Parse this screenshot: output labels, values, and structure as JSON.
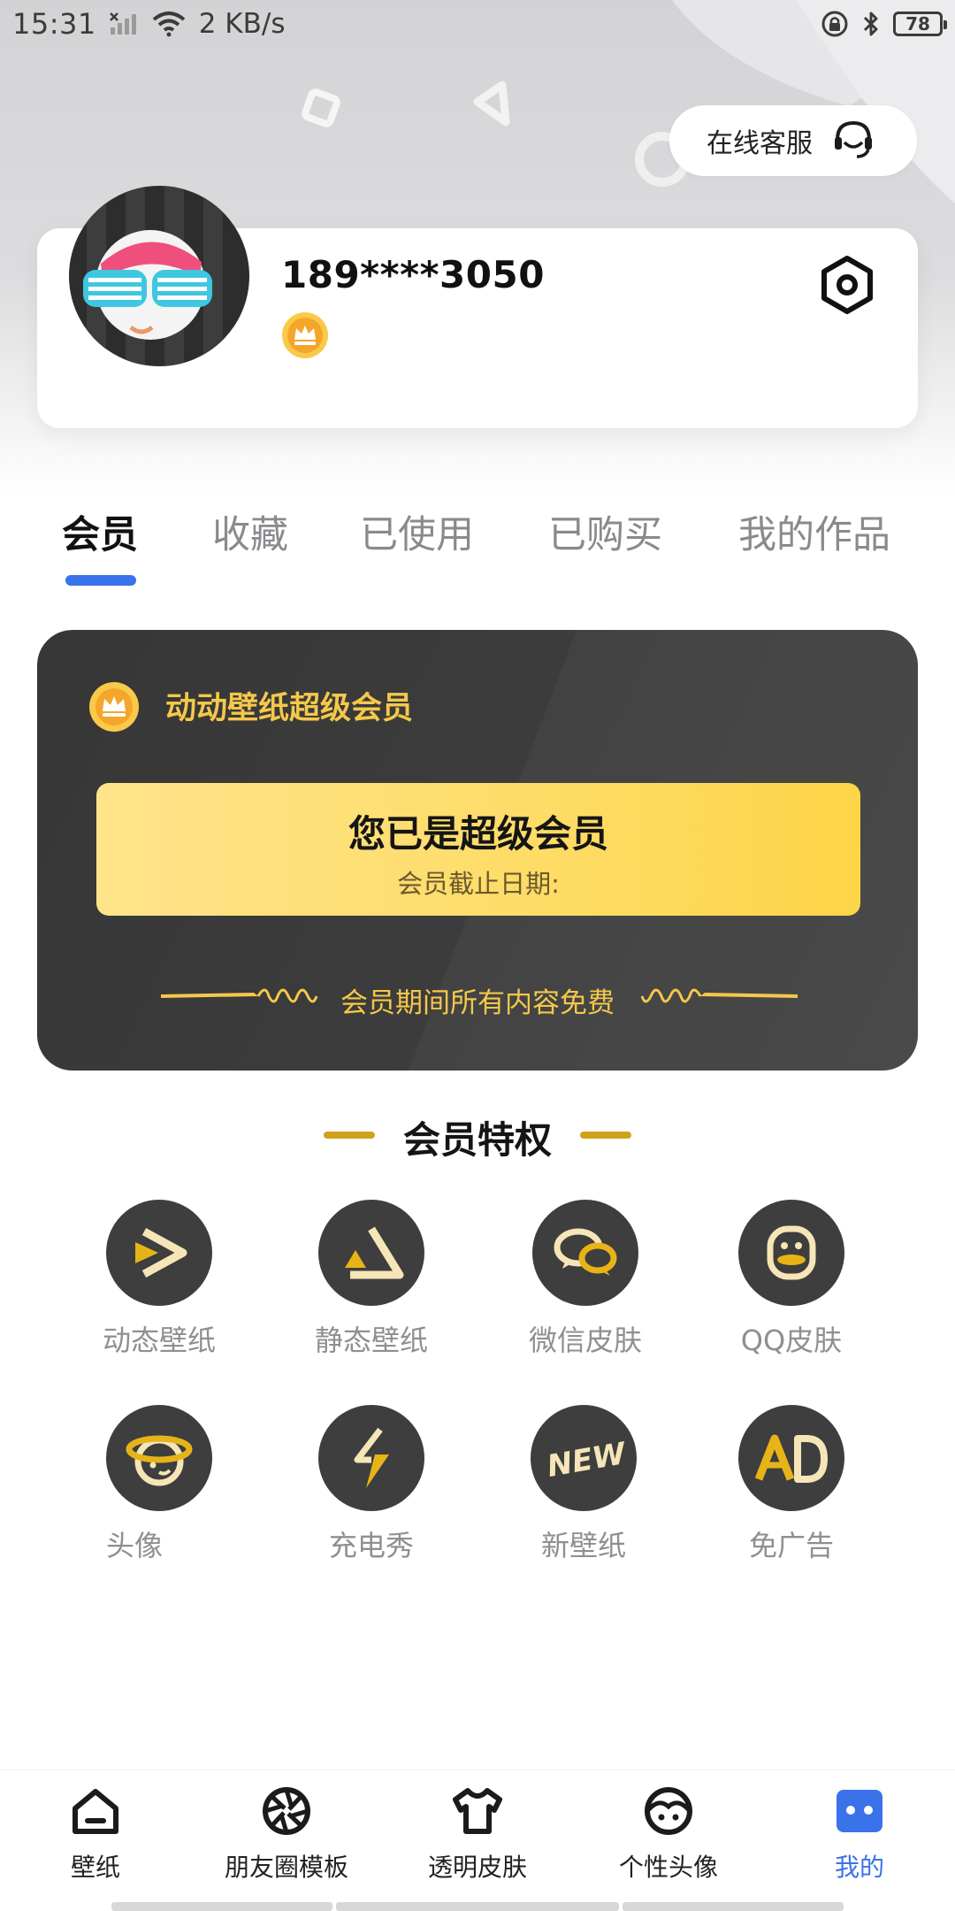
{
  "status_bar": {
    "time": "15:31",
    "net_speed": "2 KB/s",
    "battery": "78"
  },
  "header": {
    "service_label": "在线客服"
  },
  "profile": {
    "phone": "189****3050"
  },
  "tabs": [
    {
      "label": "会员"
    },
    {
      "label": "收藏"
    },
    {
      "label": "已使用"
    },
    {
      "label": "已购买"
    },
    {
      "label": "我的作品"
    }
  ],
  "member_card": {
    "title": "动动壁纸超级会员",
    "status": "您已是超级会员",
    "expiry_label": "会员截止日期:",
    "footer": "会员期间所有内容免费"
  },
  "privileges": {
    "title": "会员特权",
    "items": [
      {
        "label": "动态壁纸",
        "icon": "play-icon"
      },
      {
        "label": "静态壁纸",
        "icon": "triangle-icon"
      },
      {
        "label": "微信皮肤",
        "icon": "wechat-icon"
      },
      {
        "label": "QQ皮肤",
        "icon": "qq-penguin-icon"
      },
      {
        "label": "头像",
        "icon": "planet-face-icon"
      },
      {
        "label": "充电秀",
        "icon": "lightning-icon"
      },
      {
        "label": "新壁纸",
        "icon": "new-badge-icon"
      },
      {
        "label": "免广告",
        "icon": "ad-icon"
      }
    ]
  },
  "bottom_nav": [
    {
      "label": "壁纸",
      "icon": "home-icon"
    },
    {
      "label": "朋友圈模板",
      "icon": "aperture-icon"
    },
    {
      "label": "透明皮肤",
      "icon": "tshirt-icon"
    },
    {
      "label": "个性头像",
      "icon": "face-icon"
    },
    {
      "label": "我的",
      "icon": "profile-box-icon",
      "active": true
    }
  ],
  "colors": {
    "accent_blue": "#3a72ea",
    "gold": "#f5c84a",
    "card_dark": "#3a3a3a",
    "banner_yellow": "#fedd6c"
  }
}
